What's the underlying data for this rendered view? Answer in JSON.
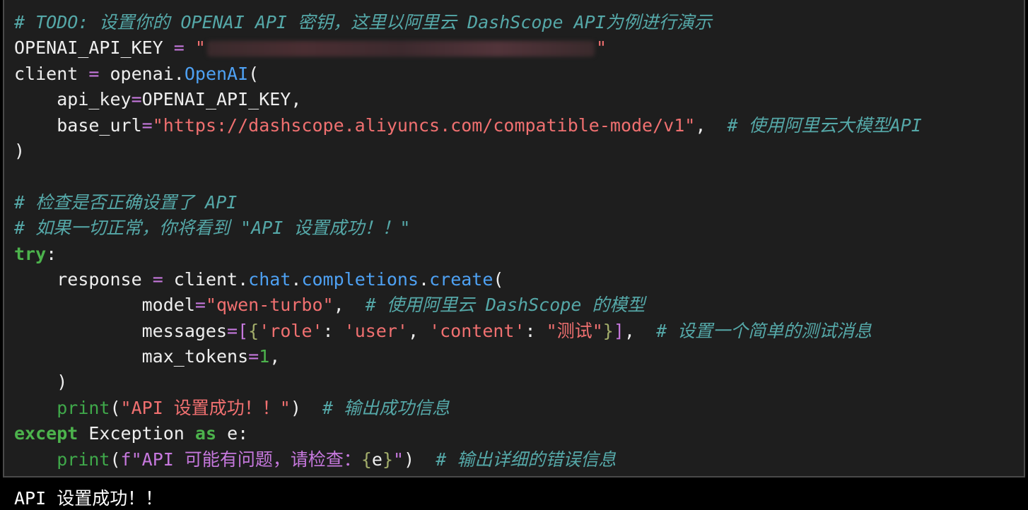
{
  "code": {
    "todo_comment": "# TODO: 设置你的 OPENAI API 密钥，这里以阿里云 DashScope API为例进行演示",
    "key_var": "OPENAI_API_KEY",
    "assign": " = ",
    "open_quote": "\"",
    "close_quote": "\"",
    "client_var": "client",
    "openai_mod": "openai",
    "dot": ".",
    "openai_cls": "OpenAI",
    "paren_open": "(",
    "paren_close": ")",
    "indent": "    ",
    "deep_indent": "            ",
    "api_key_kw": "api_key",
    "eq": "=",
    "comma": ",",
    "base_url_kw": "base_url",
    "base_url_val": "\"https://dashscope.aliyuncs.com/compatible-mode/v1\"",
    "base_url_comment": "# 使用阿里云大模型API",
    "check_comment": "# 检查是否正确设置了 API",
    "expect_comment": "# 如果一切正常，你将看到 \"API 设置成功！！\"",
    "try_kw": "try",
    "colon": ":",
    "response_var": "response",
    "chat_attr": "chat",
    "completions_attr": "completions",
    "create_fn": "create",
    "model_kw": "model",
    "model_val": "\"qwen-turbo\"",
    "model_comment": "# 使用阿里云 DashScope 的模型",
    "messages_kw": "messages",
    "list_open": "[",
    "brace_open": "{",
    "role_key": "'role'",
    "colon_sp": ": ",
    "user_val": "'user'",
    "comma_sp": ", ",
    "content_key": "'content'",
    "test_val": "\"测试\"",
    "brace_close": "}",
    "list_close": "]",
    "messages_comment": "# 设置一个简单的测试消息",
    "max_tokens_kw": "max_tokens",
    "max_tokens_val": "1",
    "print_fn": "print",
    "success_str": "\"API 设置成功！！\"",
    "success_comment": "# 输出成功信息",
    "except_kw": "except",
    "exception_cls": "Exception",
    "as_kw": "as",
    "e_var": "e",
    "fstring_start": "f\"API 可能有问题，请检查：",
    "fstring_end": "\"",
    "error_comment": "# 输出详细的错误信息"
  },
  "output": {
    "text": "API 设置成功！！"
  }
}
